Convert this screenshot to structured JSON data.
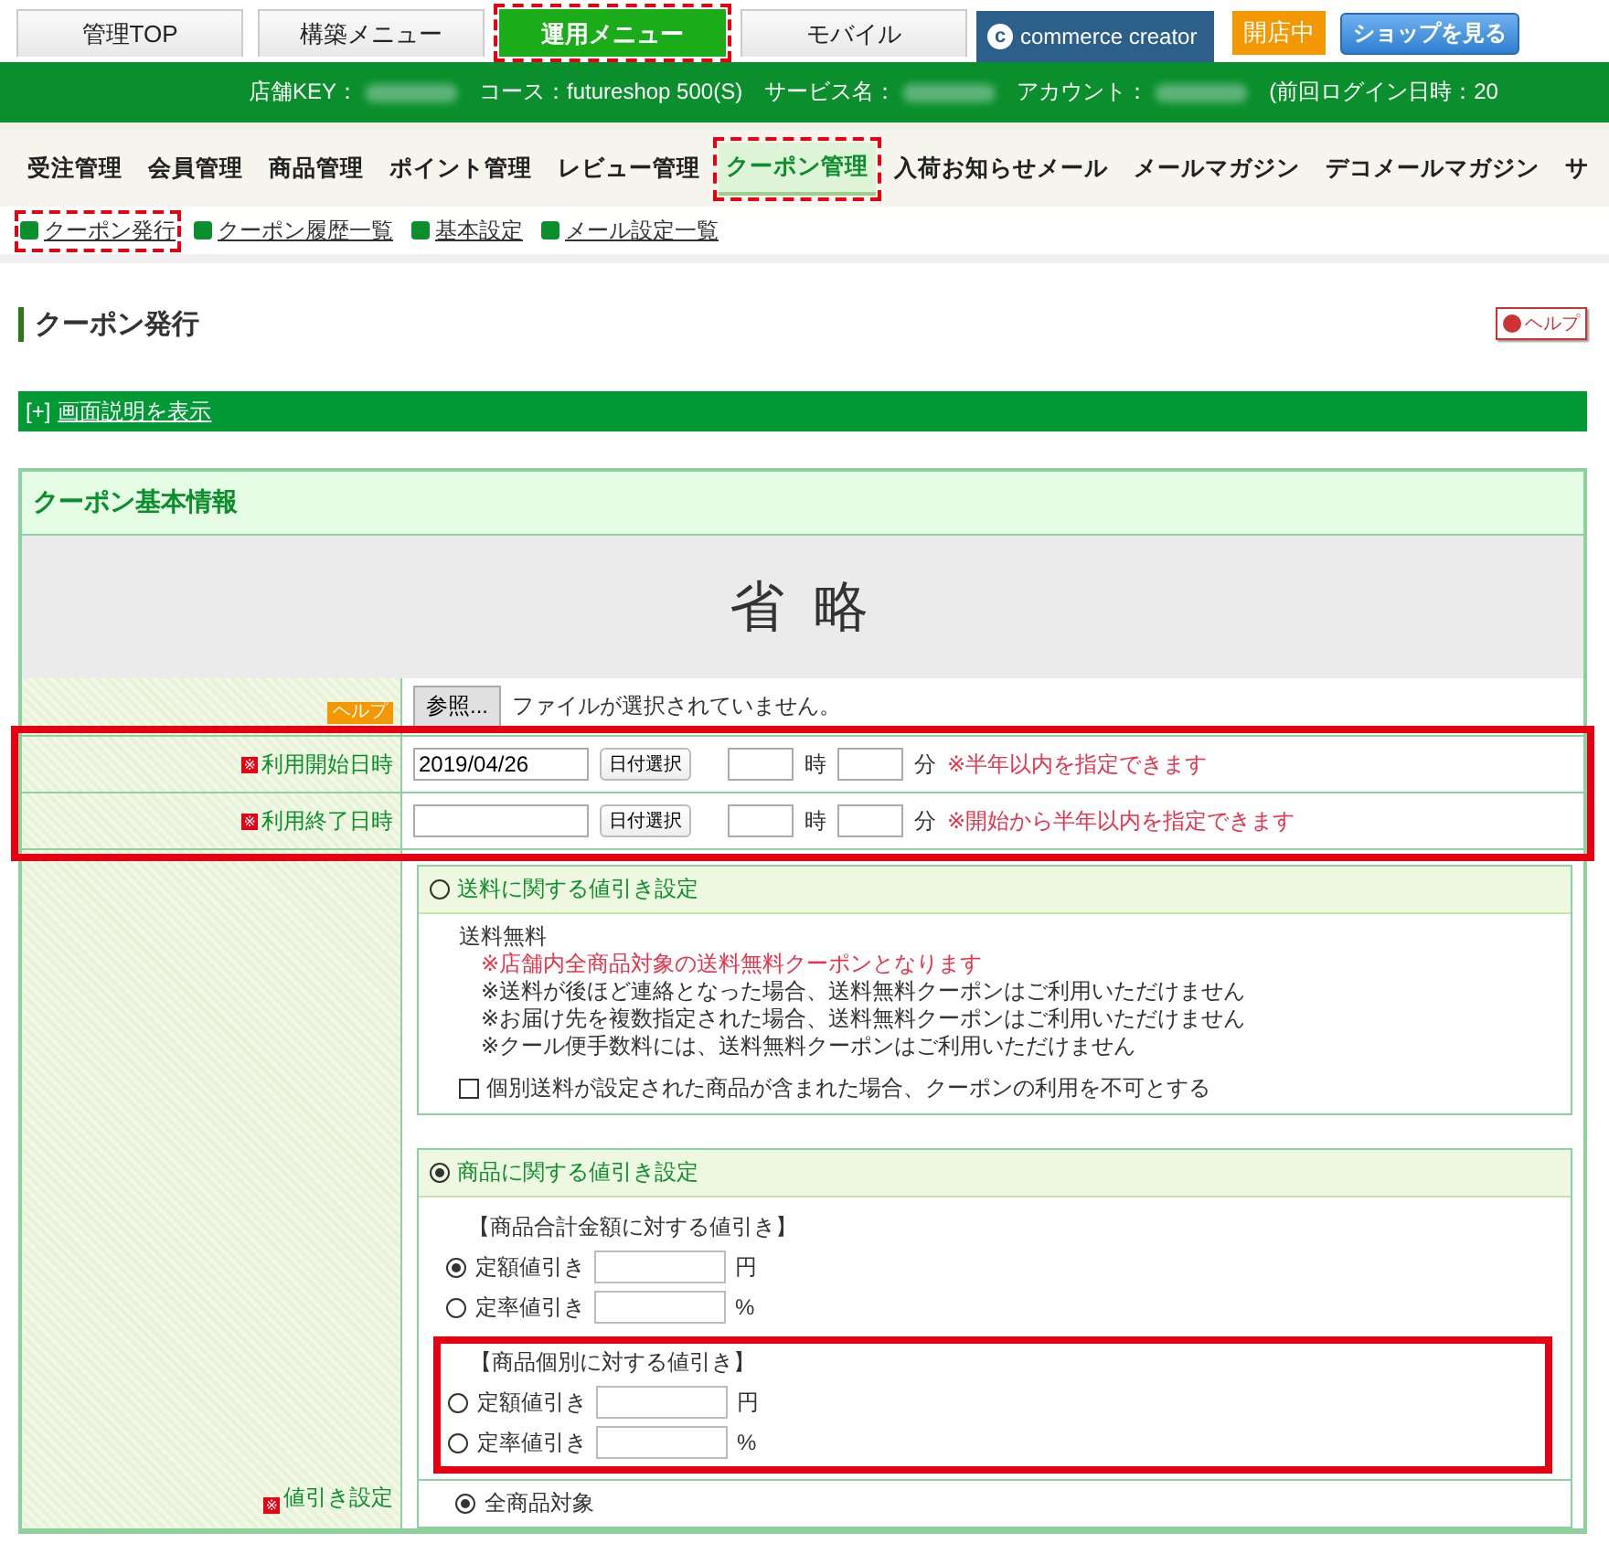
{
  "top_tabs": [
    {
      "label": "管理TOP",
      "selected": false,
      "highlighted": false
    },
    {
      "label": "構築メニュー",
      "selected": false,
      "highlighted": false
    },
    {
      "label": "運用メニュー",
      "selected": true,
      "highlighted": true
    },
    {
      "label": "モバイル",
      "selected": false,
      "highlighted": false
    }
  ],
  "brand": {
    "mark": "c",
    "label": "commerce creator"
  },
  "status_badge": "開店中",
  "shop_button": "ショップを見る",
  "info_bar": [
    {
      "label": "店舗KEY：",
      "redacted": true
    },
    {
      "label": "コース：futureshop 500(S)",
      "redacted": false
    },
    {
      "label": "サービス名：",
      "redacted": true
    },
    {
      "label": "アカウント：",
      "redacted": true
    },
    {
      "label": "(前回ログイン日時：20",
      "redacted": false
    }
  ],
  "main_nav": [
    {
      "label": "受注管理",
      "selected": false,
      "highlighted": false
    },
    {
      "label": "会員管理",
      "selected": false,
      "highlighted": false
    },
    {
      "label": "商品管理",
      "selected": false,
      "highlighted": false
    },
    {
      "label": "ポイント管理",
      "selected": false,
      "highlighted": false
    },
    {
      "label": "レビュー管理",
      "selected": false,
      "highlighted": false
    },
    {
      "label": "クーポン管理",
      "selected": true,
      "highlighted": true
    },
    {
      "label": "入荷お知らせメール",
      "selected": false,
      "highlighted": false
    },
    {
      "label": "メールマガジン",
      "selected": false,
      "highlighted": false
    },
    {
      "label": "デコメールマガジン",
      "selected": false,
      "highlighted": false
    },
    {
      "label": "サ",
      "selected": false,
      "highlighted": false
    }
  ],
  "sub_nav": [
    {
      "label": "クーポン発行",
      "highlighted": true
    },
    {
      "label": "クーポン履歴一覧",
      "highlighted": false
    },
    {
      "label": "基本設定",
      "highlighted": false
    },
    {
      "label": "メール設定一覧",
      "highlighted": false
    }
  ],
  "page_title": "クーポン発行",
  "help_button": "ヘルプ",
  "description_toggle": {
    "marker": "[+]",
    "link": "画面説明を表示"
  },
  "section": {
    "title": "クーポン基本情報",
    "omitted_banner": "省 略",
    "image_row": {
      "help_badge": "ヘルプ",
      "browse_button": "参照...",
      "file_status": "ファイルが選択されていません。"
    },
    "required_mark": "※",
    "date_rows": {
      "highlighted": true,
      "rows": [
        {
          "label": "利用開始日時",
          "required": true,
          "value": "2019/04/26",
          "picker": "日付選択",
          "hour_unit": "時",
          "minute_unit": "分",
          "note": "※半年以内を指定できます"
        },
        {
          "label": "利用終了日時",
          "required": true,
          "value": "",
          "picker": "日付選択",
          "hour_unit": "時",
          "minute_unit": "分",
          "note": "※開始から半年以内を指定できます"
        }
      ]
    },
    "discount": {
      "label": "値引き設定",
      "required": true,
      "shipping": {
        "title": "送料に関する値引き設定",
        "selected": false,
        "heading": "送料無料",
        "notes": [
          {
            "text": "※店舗内全商品対象の送料無料クーポンとなります",
            "emphasis": true
          },
          {
            "text": "※送料が後ほど連絡となった場合、送料無料クーポンはご利用いただけません",
            "emphasis": false
          },
          {
            "text": "※お届け先を複数指定された場合、送料無料クーポンはご利用いただけません",
            "emphasis": false
          },
          {
            "text": "※クール便手数料には、送料無料クーポンはご利用いただけません",
            "emphasis": false
          }
        ],
        "checkbox": {
          "label": "個別送料が設定された商品が含まれた場合、クーポンの利用を不可とする",
          "checked": false
        }
      },
      "product": {
        "title": "商品に関する値引き設定",
        "selected": true,
        "groups": [
          {
            "title": "【商品合計金額に対する値引き】",
            "highlighted": false,
            "choices": [
              {
                "label": "定額値引き",
                "unit": "円",
                "selected": true
              },
              {
                "label": "定率値引き",
                "unit": "%",
                "selected": false
              }
            ]
          },
          {
            "title": "【商品個別に対する値引き】",
            "highlighted": true,
            "choices": [
              {
                "label": "定額値引き",
                "unit": "円",
                "selected": false
              },
              {
                "label": "定率値引き",
                "unit": "%",
                "selected": false
              }
            ]
          }
        ]
      },
      "scope": {
        "label": "全商品対象",
        "selected": true
      }
    }
  }
}
